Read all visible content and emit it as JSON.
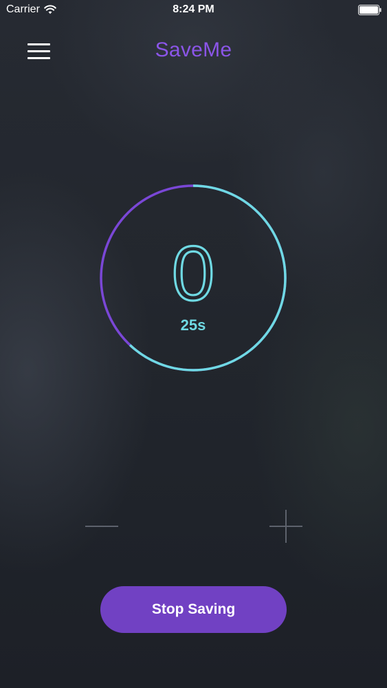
{
  "status_bar": {
    "carrier": "Carrier",
    "time": "8:24 PM",
    "wifi_icon": "wifi-icon",
    "battery_icon": "battery-icon"
  },
  "header": {
    "menu_icon": "hamburger-menu-icon",
    "title": "SaveMe"
  },
  "timer": {
    "count": "0",
    "time_label": "25s",
    "progress_fraction": 0.62,
    "colors": {
      "remaining": "#6fd9e3",
      "elapsed": "#7a47d6"
    }
  },
  "controls": {
    "minus_icon": "minus-icon",
    "plus_icon": "plus-icon",
    "stop_label": "Stop Saving"
  },
  "colors": {
    "accent": "#7141c3",
    "title": "#8b55e8",
    "cyan": "#6fd9e3",
    "background": "#22262d"
  }
}
